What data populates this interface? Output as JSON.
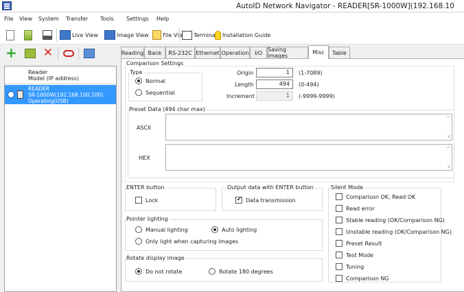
{
  "window": {
    "title": "AutoID Network Navigator - READER[SR-1000W](192.168.10"
  },
  "menu": [
    "File",
    "View",
    "System",
    "Transfer",
    "Tools",
    "Settings",
    "Help"
  ],
  "toolbar": {
    "live_view": "Live View",
    "image_view": "Image View",
    "file_view": "File View",
    "terminal": "Terminal",
    "installation_guide": "Installation Guide"
  },
  "device_list": {
    "header_line1": "Reader",
    "header_line2": "Model (IP address)",
    "device_name": "READER",
    "device_model": "SR-1000W(192.168.100.100)",
    "device_status": "Operating(USB)"
  },
  "tabs": [
    "Reading",
    "Bank",
    "RS-232C",
    "Ethernet",
    "Operation",
    "I/O",
    "Saving Images",
    "Misc",
    "Table"
  ],
  "active_tab": "Misc",
  "comparison": {
    "title": "Comparison Settings",
    "type_label": "Type",
    "type_normal": "Normal",
    "type_sequential": "Sequential",
    "type_selected": "Normal",
    "origin_label": "Origin",
    "origin_value": "1",
    "origin_range": "(1-7089)",
    "length_label": "Length",
    "length_value": "494",
    "length_range": "(0-494)",
    "increment_label": "Increment",
    "increment_value": "1",
    "increment_range": "(-9999-9999)"
  },
  "preset": {
    "title": "Preset Data (494 char max)",
    "ascii_label": "ASCII",
    "hex_label": "HEX",
    "ascii_value": "",
    "hex_value": ""
  },
  "enter_button": {
    "title": "ENTER button",
    "lock": "Lock",
    "lock_checked": false
  },
  "output_enter": {
    "title": "Output data with ENTER button",
    "data_transmission": "Data transmission",
    "data_transmission_checked": true
  },
  "pointer": {
    "title": "Pointer lighting",
    "manual": "Manual lighting",
    "auto": "Auto lighting",
    "capturing": "Only light when capturing images",
    "selected": "Auto lighting"
  },
  "rotate": {
    "title": "Rotate display image",
    "no_rotate": "Do not rotate",
    "rotate_180": "Rotate 180 degrees",
    "selected": "Do not rotate"
  },
  "silent_mode": {
    "title": "Silent Mode",
    "items": [
      {
        "label": "Comparison OK, Read OK",
        "checked": false
      },
      {
        "label": "Read error",
        "checked": false
      },
      {
        "label": "Stable reading (OK/Comparison NG)",
        "checked": false
      },
      {
        "label": "Unstable reading (OK/Comparison NG)",
        "checked": false
      },
      {
        "label": "Preset Result",
        "checked": false
      },
      {
        "label": "Test Mode",
        "checked": false
      },
      {
        "label": "Tuning",
        "checked": false
      },
      {
        "label": "Comparison NG",
        "checked": false
      }
    ]
  },
  "colors": {
    "selection": "#3399ff",
    "accent_blue": "#3a63b8"
  }
}
